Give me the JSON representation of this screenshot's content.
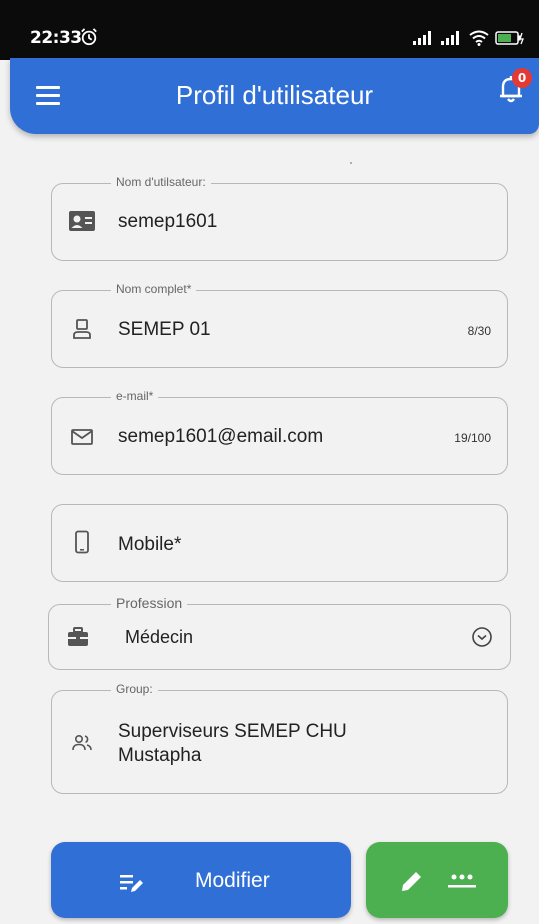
{
  "status_bar": {
    "time": "22:33"
  },
  "app_bar": {
    "title": "Profil d'utilisateur",
    "notification_count": "0"
  },
  "form": {
    "username": {
      "label": "Nom d'utilsateur:",
      "value": "semep1601"
    },
    "fullname": {
      "label": "Nom complet*",
      "value": "SEMEP 01",
      "counter": "8/30"
    },
    "email": {
      "label": "e-mail*",
      "value": "semep1601@email.com",
      "counter": "19/100"
    },
    "mobile": {
      "placeholder": "Mobile*"
    },
    "profession": {
      "label": "Profession",
      "value": "Médecin"
    },
    "group": {
      "label": "Group:",
      "value_line1": "Superviseurs SEMEP CHU",
      "value_line2": "Mustapha"
    }
  },
  "actions": {
    "modify_label": "Modifier"
  },
  "colors": {
    "primary": "#2f6fd6",
    "success": "#4caf50",
    "badge": "#e53935",
    "background": "#f2f2f2"
  }
}
